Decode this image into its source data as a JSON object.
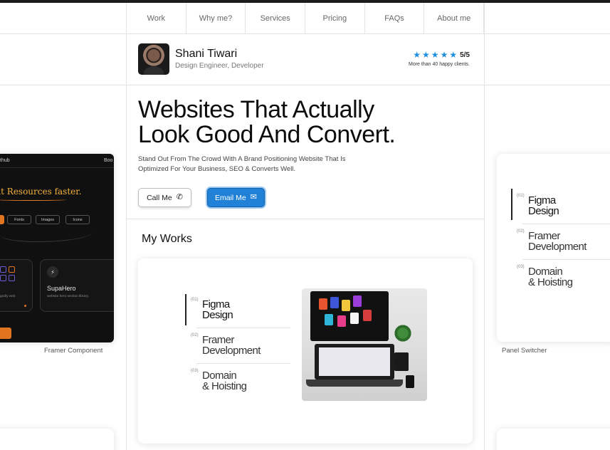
{
  "nav": {
    "items": [
      "Work",
      "Why me?",
      "Services",
      "Pricing",
      "FAQs",
      "About me"
    ]
  },
  "profile": {
    "name": "Shani Tiwari",
    "role": "Design Engineer, Developer",
    "rating": "5/5",
    "stars": 5,
    "rating_note": "More than 40 happy clients."
  },
  "hero": {
    "title_line1": "Websites That Actually",
    "title_line2": "Look Good And Convert.",
    "subtitle_line1": "Stand Out From The Crowd With A Brand Positioning Website That Is",
    "subtitle_line2": "Optimized For Your Business, SEO & Converts Well.",
    "call_label": "Call Me",
    "email_label": "Email Me"
  },
  "works": {
    "title": "My Works",
    "panel": [
      {
        "num": "(01)",
        "line1": "Figma",
        "line2": "Design",
        "active": true
      },
      {
        "num": "(02)",
        "line1": "Framer",
        "line2": "Development",
        "active": false
      },
      {
        "num": "(03)",
        "line1": "Domain",
        "line2": "& Hoisting",
        "active": false
      }
    ],
    "left_caption": "Framer Component",
    "right_caption": "Panel Switcher"
  },
  "dark_card": {
    "top_left": "thub",
    "top_right": "Boo",
    "headline": "at Resources faster.",
    "pills": [
      "Fonts",
      "Images",
      "Icons"
    ],
    "box_title": "SupaHero",
    "box_desc": "website hero section library.",
    "box_left_desc": "godly web"
  },
  "colors": {
    "accent_blue": "#2181d6",
    "star_blue": "#1e8fe0",
    "dark_card_bg": "#101010",
    "dark_card_orange": "#e0741f"
  }
}
